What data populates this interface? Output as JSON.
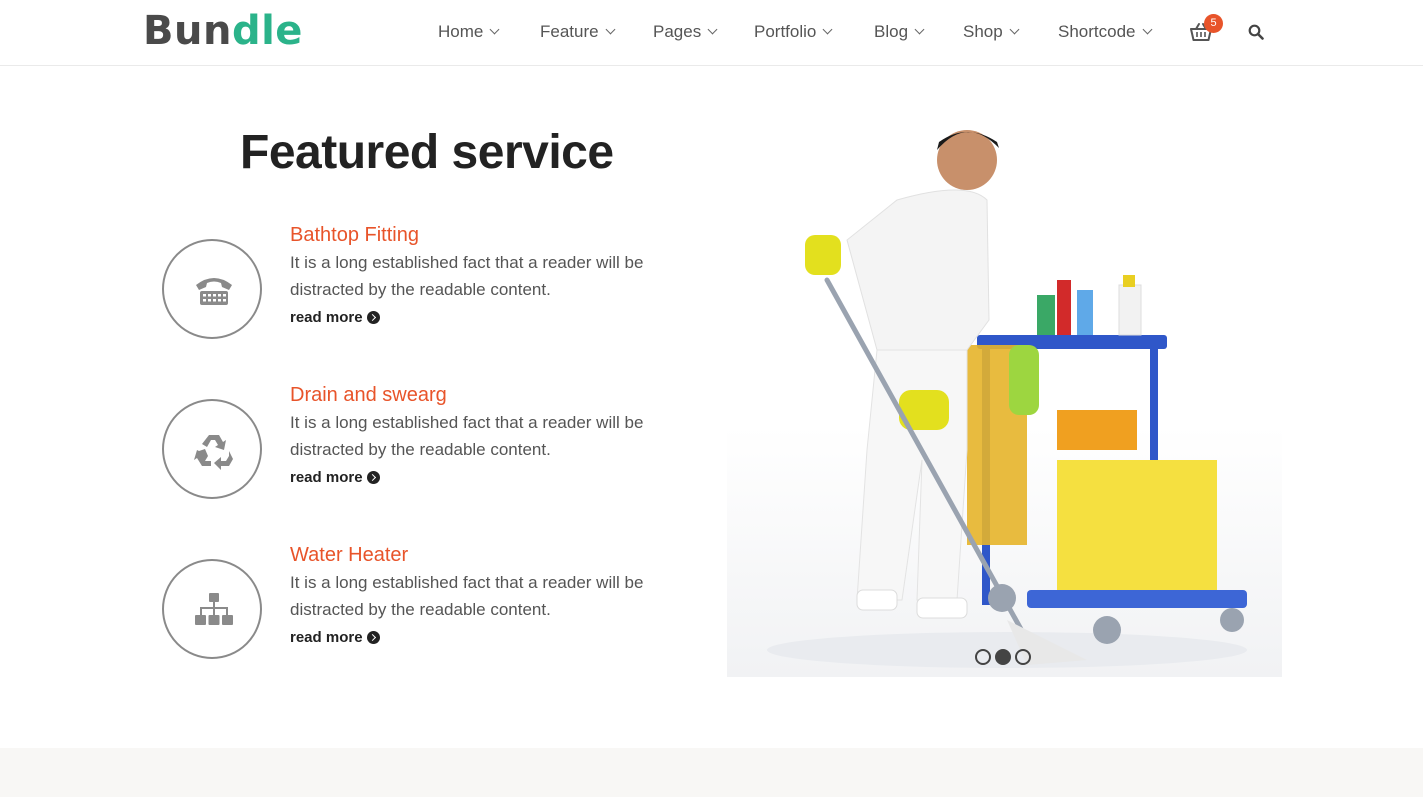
{
  "header": {
    "logo_part1": "Bun",
    "logo_part2": "dle",
    "nav": [
      {
        "label": "Home"
      },
      {
        "label": "Feature"
      },
      {
        "label": "Pages"
      },
      {
        "label": "Portfolio"
      },
      {
        "label": "Blog"
      },
      {
        "label": "Shop"
      },
      {
        "label": "Shortcode"
      }
    ],
    "cart_count": "5",
    "cart_icon": "basket-icon",
    "search_icon": "search-icon"
  },
  "section": {
    "title": "Featured service",
    "services": [
      {
        "title": "Bathtop Fitting",
        "desc": "It is a long established fact that a reader will be distracted by the readable content.",
        "more": "read more",
        "icon": "phone-icon"
      },
      {
        "title": "Drain and swearg",
        "desc": "It is a long established fact that a reader will be distracted by the readable content.",
        "more": "read more",
        "icon": "recycle-icon"
      },
      {
        "title": "Water Heater",
        "desc": "It is a long established fact that a reader will be distracted by the readable content.",
        "more": "read more",
        "icon": "sitemap-icon"
      }
    ]
  },
  "slider": {
    "slide_count": 3,
    "active_slide": 2
  },
  "colors": {
    "accent": "#e8542a",
    "brand": "#2bb38a",
    "text_dark": "#222222"
  }
}
